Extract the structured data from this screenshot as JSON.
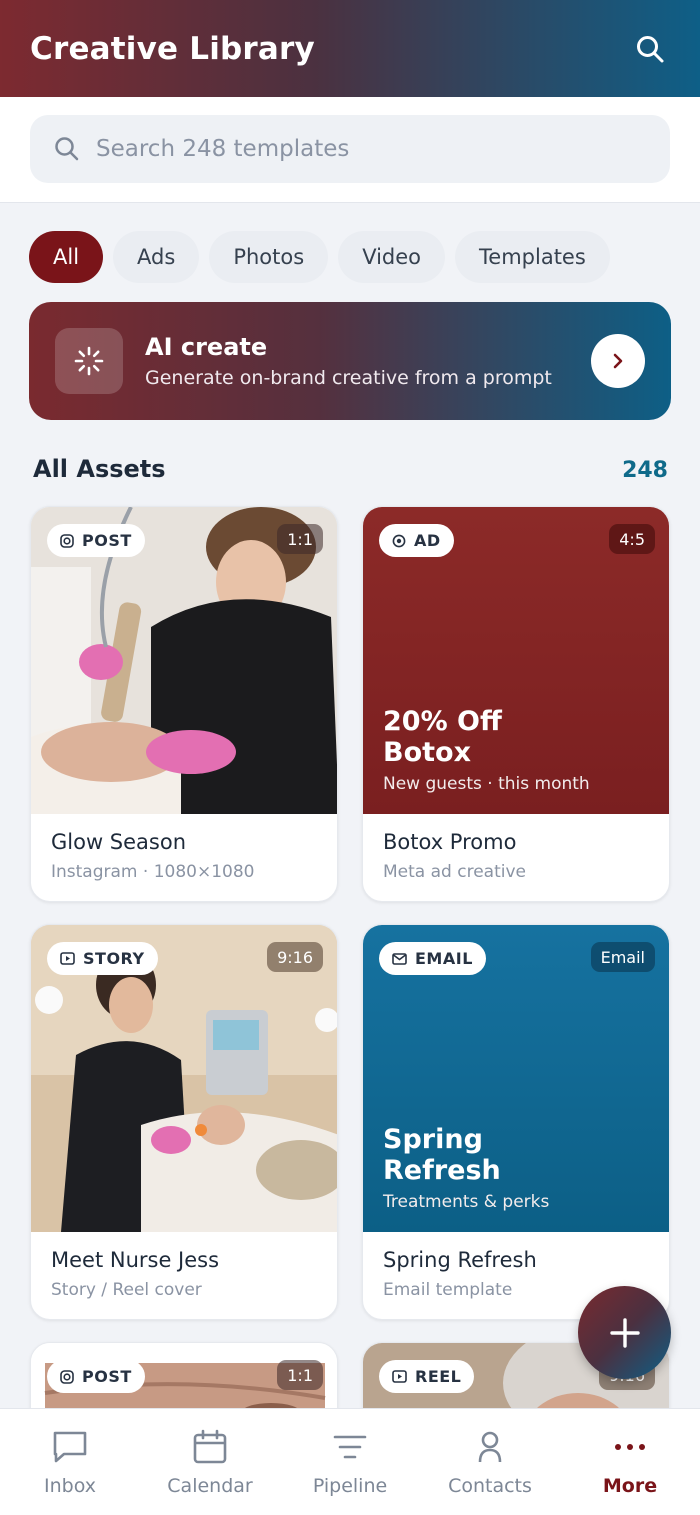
{
  "header": {
    "title": "Creative Library"
  },
  "search": {
    "placeholder": "Search 248 templates"
  },
  "chips": [
    "All",
    "Ads",
    "Photos",
    "Video",
    "Templates"
  ],
  "ai_banner": {
    "title": "AI create",
    "subtitle": "Generate on-brand creative from a prompt"
  },
  "section": {
    "title": "All Assets",
    "count": "248"
  },
  "cards": [
    {
      "badge": "POST",
      "ratio": "1:1",
      "title": "Glow Season",
      "subtitle": "Instagram · 1080×1080"
    },
    {
      "badge": "AD",
      "ratio": "4:5",
      "title": "Botox Promo",
      "subtitle": "Meta ad creative",
      "headline": "20% Off\nBotox",
      "tagline": "New guests · this month"
    },
    {
      "badge": "STORY",
      "ratio": "9:16",
      "title": "Meet Nurse Jess",
      "subtitle": "Story / Reel cover"
    },
    {
      "badge": "EMAIL",
      "ratio": "Email",
      "title": "Spring Refresh",
      "subtitle": "Email template",
      "headline": "Spring\nRefresh",
      "tagline": "Treatments & perks"
    },
    {
      "badge": "POST",
      "ratio": "1:1"
    },
    {
      "badge": "REEL",
      "ratio": "9:16"
    }
  ],
  "nav": [
    {
      "label": "Inbox",
      "icon": "chat-bubble-icon"
    },
    {
      "label": "Calendar",
      "icon": "calendar-icon"
    },
    {
      "label": "Pipeline",
      "icon": "funnel-icon"
    },
    {
      "label": "Contacts",
      "icon": "person-icon"
    },
    {
      "label": "More",
      "icon": "dots-icon"
    }
  ],
  "colors": {
    "brand_red": "#7a1419",
    "brand_blue": "#0d5f86",
    "accent_count": "#0f6a8a"
  }
}
